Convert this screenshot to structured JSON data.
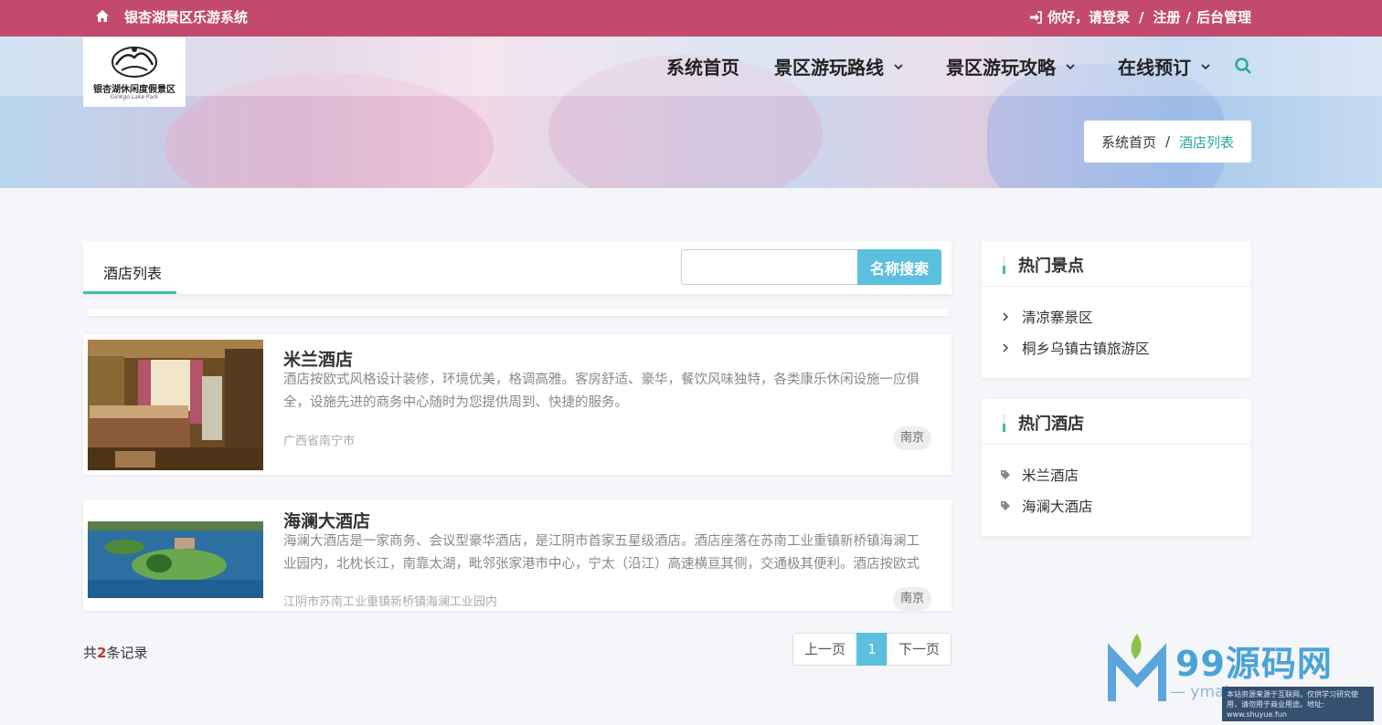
{
  "topbar": {
    "site_title": "银杏湖景区乐游系统",
    "greeting": "你好，请登录",
    "sep1": "/",
    "register": "注册",
    "sep2": "/",
    "admin": "后台管理"
  },
  "logo": {
    "text": "银杏湖休闲度假景区",
    "sub": "Ginkgo Lake Park"
  },
  "nav": {
    "home": "系统首页",
    "routes": "景区游玩路线",
    "guides": "景区游玩攻略",
    "booking": "在线预订"
  },
  "breadcrumb": {
    "home": "系统首页",
    "sep": "/",
    "current": "酒店列表"
  },
  "panel": {
    "tab": "酒店列表",
    "search_placeholder": "",
    "search_button": "名称搜索"
  },
  "hotels": [
    {
      "name": "米兰酒店",
      "desc": "酒店按欧式风格设计装修，环境优美，格调高雅。客房舒适、豪华，餐饮风味独特，各类康乐休闲设施一应俱全，设施先进的商务中心随时为您提供周到、快捷的服务。",
      "address": "广西省南宁市",
      "city": "南京"
    },
    {
      "name": "海澜大酒店",
      "desc": "海澜大酒店是一家商务、会议型豪华酒店，是江阴市首家五星级酒店。酒店座落在苏南工业重镇新桥镇海澜工业园内，北枕长江，南靠太湖，毗邻张家港市中心，宁太（沿江）高速横亘其侧，交通极其便利。酒店按欧式",
      "address": "江阴市苏南工业重镇新桥镇海澜工业园内",
      "city": "南京"
    }
  ],
  "footer": {
    "total_prefix": "共",
    "total_count": "2",
    "total_suffix": "条记录",
    "prev": "上一页",
    "current_page": "1",
    "next": "下一页"
  },
  "sidebar": {
    "hot_spots_title": "热门景点",
    "hot_spots": [
      "清凉寨景区",
      "桐乡乌镇古镇旅游区"
    ],
    "hot_hotels_title": "热门酒店",
    "hot_hotels": [
      "米兰酒店",
      "海澜大酒店"
    ]
  },
  "watermark": {
    "brand": "99源码网",
    "url": "— ymaiu.com",
    "note": "本站资源来源于互联网，仅供学习研究使用，请勿用于商业用途。地址: www.shuyue.fun"
  },
  "colors": {
    "topbar": "#c34a6e",
    "accent": "#3fbf98",
    "button": "#5bc0de",
    "breadcrumb_active": "#2aa6a0"
  }
}
